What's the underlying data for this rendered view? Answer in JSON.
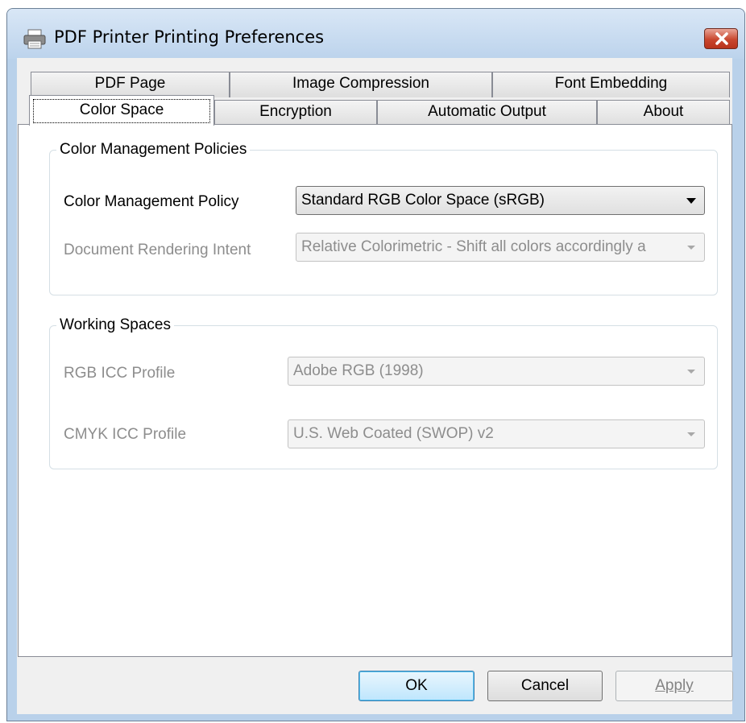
{
  "window": {
    "title": "PDF Printer Printing Preferences",
    "icon": "printer-icon",
    "close_icon": "close-icon"
  },
  "tabs": {
    "row_back": [
      "PDF Page",
      "Image Compression",
      "Font Embedding"
    ],
    "row_front": [
      "Color Space",
      "Encryption",
      "Automatic Output",
      "About"
    ],
    "active": "Color Space"
  },
  "color_management": {
    "legend": "Color Management Policies",
    "policy_label": "Color Management Policy",
    "policy_value": "Standard RGB Color Space (sRGB)",
    "intent_label": "Document Rendering Intent",
    "intent_value": "Relative Colorimetric - Shift all colors accordingly a"
  },
  "working_spaces": {
    "legend": "Working Spaces",
    "rgb_label": "RGB ICC Profile",
    "rgb_value": "Adobe RGB (1998)",
    "cmyk_label": "CMYK ICC Profile",
    "cmyk_value": "U.S. Web Coated (SWOP) v2"
  },
  "buttons": {
    "ok": "OK",
    "cancel": "Cancel",
    "apply": "Apply"
  },
  "colors": {
    "frame": "#b9d1ea",
    "close": "#c9472f",
    "default_button_border": "#3c7fb1"
  }
}
